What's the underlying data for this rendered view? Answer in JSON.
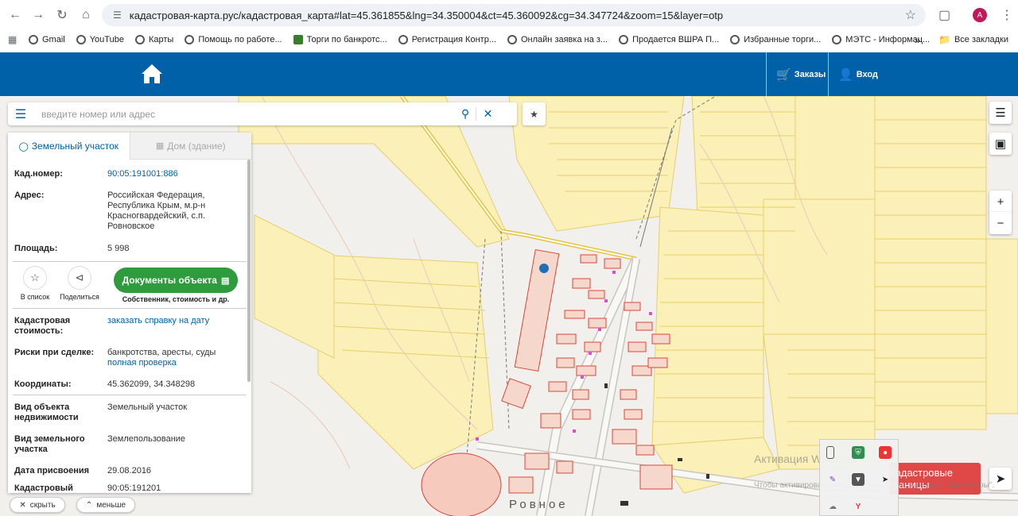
{
  "browser": {
    "url": "кадастровая-карта.рус/кадастровая_карта#lat=45.361855&lng=34.350004&ct=45.360092&cg=34.347724&zoom=15&layer=otp",
    "avatar_letter": "A",
    "bookmarks": [
      {
        "label": "Gmail"
      },
      {
        "label": "YouTube"
      },
      {
        "label": "Карты"
      },
      {
        "label": "Помощь по работе..."
      },
      {
        "label": "Торги по банкротс..."
      },
      {
        "label": "Регистрация Контр..."
      },
      {
        "label": "Онлайн заявка на з..."
      },
      {
        "label": "Продается ВШРА П..."
      },
      {
        "label": "Избранные торги..."
      },
      {
        "label": "МЭТС - Информац..."
      }
    ],
    "more_bookmarks": "»",
    "all_bookmarks": "Все закладки"
  },
  "header": {
    "orders_label": "Заказы",
    "login_label": "Вход",
    "color": "#0061a8"
  },
  "search": {
    "placeholder": "введите номер или адрес",
    "value": ""
  },
  "panel": {
    "tab_land": "Земельный участок",
    "tab_house": "Дом (здание)",
    "cad_number_label": "Кад.номер:",
    "cad_number_value": "90:05:191001:886",
    "address_label": "Адрес:",
    "address_value": "Российская Федерация, Республика Крым, м.р-н Красногвардейский, с.п. Ровновское",
    "area_label": "Площадь:",
    "area_value": "5 998",
    "to_list_label": "В список",
    "share_label": "Поделиться",
    "docs_button": "Документы объекта",
    "docs_sub": "Собственник, стоимость и др.",
    "cad_cost_label": "Кадастровая стоимость:",
    "cad_cost_value": "заказать справку на дату",
    "risks_label": "Риски при сделке:",
    "risks_value": "банкротства, аресты, суды",
    "risks_link": "полная проверка",
    "coords_label": "Координаты:",
    "coords_value": "45.362099, 34.348298",
    "obj_type_label": "Вид объекта недвижимости",
    "obj_type_value": "Земельный участок",
    "land_type_label": "Вид земельного участка",
    "land_type_value": "Землепользование",
    "date_label": "Дата присвоения",
    "date_value": "29.08.2016",
    "cad_quarter_label": "Кадастровый",
    "cad_quarter_value": "90:05:191201"
  },
  "bottom": {
    "hide_label": "скрыть",
    "less_label": "меньше",
    "borders_button": "Кадастровые границы",
    "town_label": "Ровное",
    "watermark_title": "Активация Windows",
    "watermark_sub": "Чтобы активировать Windows, перейдите в раздел \"Параметры\"."
  },
  "colors": {
    "accent": "#0061a8",
    "green": "#2e9c3c",
    "red": "#e04848",
    "parcel_fill": "#fbf1b8",
    "parcel_stroke": "#e4cf6a",
    "building": "#f4c3b4",
    "building_stroke": "#d9463a"
  }
}
